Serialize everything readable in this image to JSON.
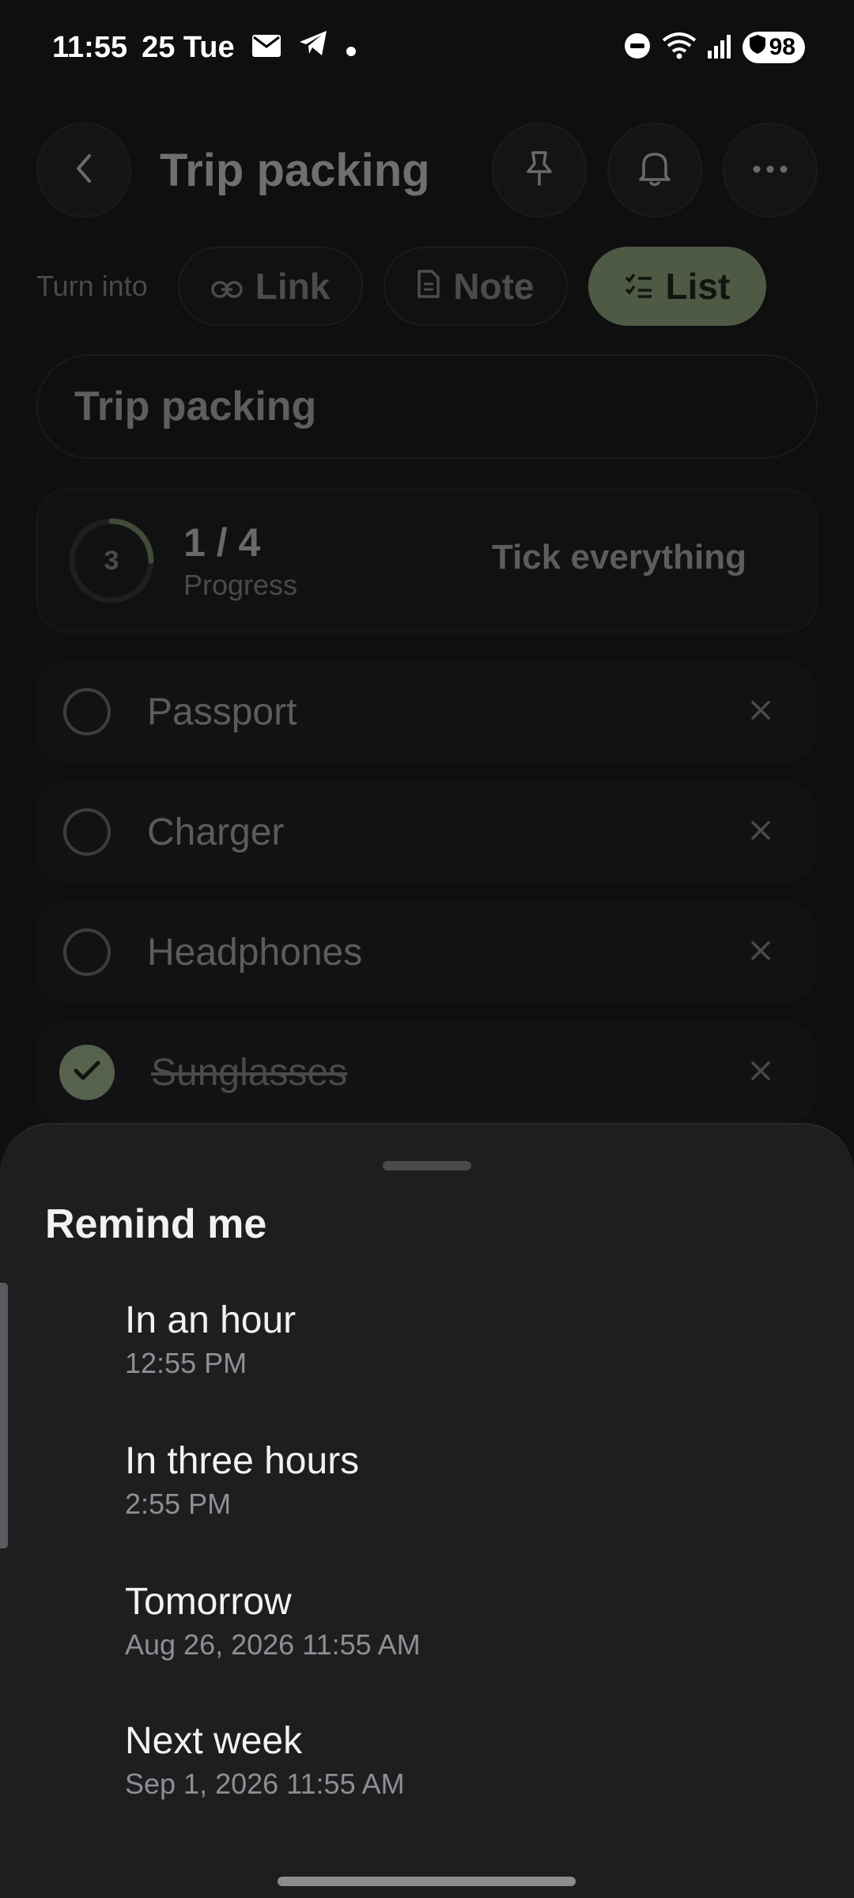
{
  "status_bar": {
    "time": "11:55",
    "date": "25 Tue",
    "battery": "98",
    "icons": [
      "mail-icon",
      "telegram-icon",
      "dot-icon",
      "dnd-icon",
      "wifi-icon",
      "signal-icon",
      "battery-shield-icon"
    ]
  },
  "header": {
    "title": "Trip packing",
    "icons": [
      "back-icon",
      "pin-icon",
      "bell-icon",
      "more-icon"
    ]
  },
  "turn_into": {
    "label": "Turn into",
    "options": [
      {
        "label": "Link",
        "icon": "link-icon"
      },
      {
        "label": "Note",
        "icon": "note-icon"
      },
      {
        "label": "List",
        "icon": "checklist-icon",
        "active": true
      }
    ]
  },
  "list_title_field": "Trip packing",
  "progress": {
    "ring_value": "3",
    "count": "1 / 4",
    "label": "Progress",
    "fraction": 0.25,
    "tick_all": "Tick everything"
  },
  "items": [
    {
      "label": "Passport",
      "done": false
    },
    {
      "label": "Charger",
      "done": false
    },
    {
      "label": "Headphones",
      "done": false
    },
    {
      "label": "Sunglasses",
      "done": true
    }
  ],
  "sheet": {
    "title": "Remind me",
    "options": [
      {
        "label": "In an hour",
        "sub": "12:55 PM"
      },
      {
        "label": "In three hours",
        "sub": "2:55 PM"
      },
      {
        "label": "Tomorrow",
        "sub": "Aug 26, 2026 11:55 AM"
      },
      {
        "label": "Next week",
        "sub": "Sep 1, 2026 11:55 AM"
      }
    ]
  },
  "colors": {
    "background": "#0f0f10",
    "sheet": "#1e1e21",
    "accent": "#56624b"
  }
}
